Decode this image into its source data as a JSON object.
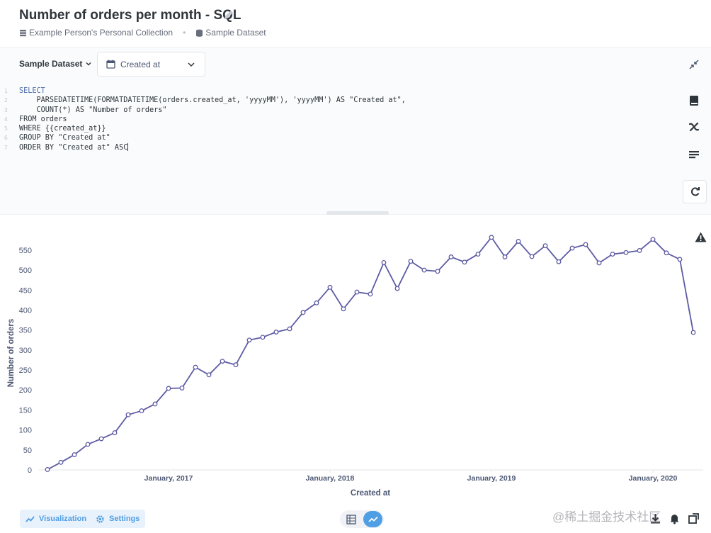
{
  "header": {
    "title": "Number of orders per month - SQL",
    "collection": "Example Person's Personal Collection",
    "dataset": "Sample Dataset"
  },
  "editor": {
    "database": "Sample Dataset",
    "variable_label": "Created at",
    "code_lines": [
      "SELECT",
      "    PARSEDATETIME(FORMATDATETIME(orders.created_at, 'yyyyMM'), 'yyyyMM') AS \"Created at\",",
      "    COUNT(*) AS \"Number of orders\"",
      "FROM orders",
      "WHERE {{created_at}}",
      "GROUP BY \"Created at\"",
      "ORDER BY \"Created at\" ASC"
    ]
  },
  "footer": {
    "visualization_label": "Visualization",
    "settings_label": "Settings",
    "watermark": "@稀土掘金技术社区"
  },
  "colors": {
    "line": "#5d5ba3",
    "accent": "#509ee3"
  },
  "chart_data": {
    "type": "line",
    "xlabel": "Created at",
    "ylabel": "Number of orders",
    "x_tick_labels": [
      "January, 2017",
      "January, 2018",
      "January, 2019",
      "January, 2020"
    ],
    "y_ticks": [
      0,
      50,
      100,
      150,
      200,
      250,
      300,
      350,
      400,
      450,
      500,
      550
    ],
    "ylim": [
      0,
      580
    ],
    "x_start": "2016-04",
    "x": [
      "2016-04",
      "2016-05",
      "2016-06",
      "2016-07",
      "2016-08",
      "2016-09",
      "2016-10",
      "2016-11",
      "2016-12",
      "2017-01",
      "2017-02",
      "2017-03",
      "2017-04",
      "2017-05",
      "2017-06",
      "2017-07",
      "2017-08",
      "2017-09",
      "2017-10",
      "2017-11",
      "2017-12",
      "2018-01",
      "2018-02",
      "2018-03",
      "2018-04",
      "2018-05",
      "2018-06",
      "2018-07",
      "2018-08",
      "2018-09",
      "2018-10",
      "2018-11",
      "2018-12",
      "2019-01",
      "2019-02",
      "2019-03",
      "2019-04",
      "2019-05",
      "2019-06",
      "2019-07",
      "2019-08",
      "2019-09",
      "2019-10",
      "2019-11",
      "2019-12",
      "2020-01",
      "2020-02",
      "2020-03",
      "2020-04"
    ],
    "series": [
      {
        "name": "Number of orders",
        "values": [
          1,
          19,
          38,
          64,
          78,
          93,
          138,
          148,
          165,
          204,
          205,
          257,
          238,
          272,
          263,
          325,
          332,
          345,
          353,
          394,
          418,
          457,
          403,
          445,
          440,
          519,
          454,
          522,
          500,
          497,
          533,
          520,
          540,
          582,
          533,
          572,
          534,
          561,
          521,
          555,
          564,
          518,
          540,
          544,
          549,
          577,
          543,
          527,
          344
        ]
      }
    ],
    "grid": false
  }
}
